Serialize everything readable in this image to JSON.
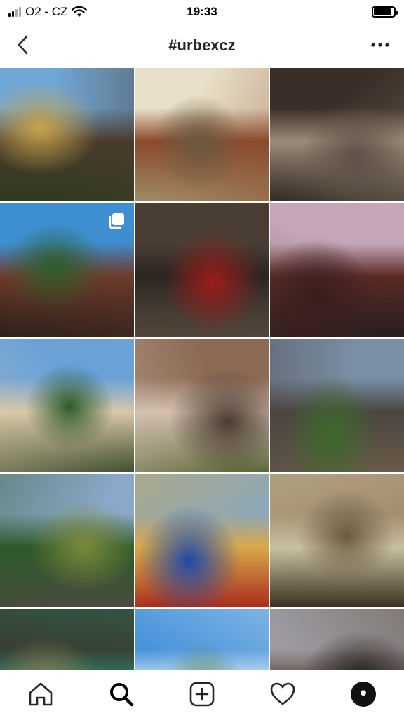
{
  "status_bar": {
    "carrier": "O2 - CZ",
    "time": "19:33",
    "signal_bars": 4,
    "signal_active": 2
  },
  "header": {
    "title": "#urbexcz",
    "back_icon": "chevron-left-icon",
    "more_icon": "more-horizontal-icon"
  },
  "posts": [
    {
      "id": "post-1",
      "subject": "graffiti-face-tower",
      "colors": [
        "#6fa7d6",
        "#4a3b2c",
        "#c7a24a",
        "#2e3b1f"
      ],
      "multi": false
    },
    {
      "id": "post-2",
      "subject": "abandoned-mine-buildings",
      "colors": [
        "#e8e0c8",
        "#8a4a2c",
        "#6b5a40",
        "#a08a64"
      ],
      "multi": false
    },
    {
      "id": "post-3",
      "subject": "ruined-interior-arch",
      "colors": [
        "#3a2f28",
        "#9c8c7a",
        "#5e5046",
        "#2a221c"
      ],
      "multi": false
    },
    {
      "id": "post-4",
      "subject": "woman-on-bridge",
      "colors": [
        "#3d8fd1",
        "#6e3b2a",
        "#2d5e2a",
        "#1e1a18"
      ],
      "multi": true
    },
    {
      "id": "post-5",
      "subject": "woman-red-dress-doors",
      "colors": [
        "#4a3d33",
        "#2a2520",
        "#9c1c1c",
        "#6b5a4a"
      ],
      "multi": false
    },
    {
      "id": "post-6",
      "subject": "dark-brick-tower",
      "colors": [
        "#c4a6b8",
        "#5a2a26",
        "#3a1e1c",
        "#1c1c1c"
      ],
      "multi": false
    },
    {
      "id": "post-7",
      "subject": "factory-pond",
      "colors": [
        "#6aa2d8",
        "#d9c8a8",
        "#2f5a2a",
        "#3a4a2a"
      ],
      "multi": false
    },
    {
      "id": "post-8",
      "subject": "graffiti-brick-wall",
      "colors": [
        "#8c6a54",
        "#d4c0b0",
        "#4a3a30",
        "#5c6a3a"
      ],
      "multi": false
    },
    {
      "id": "post-9",
      "subject": "mine-headframe",
      "colors": [
        "#7a8ea6",
        "#4a4640",
        "#3d6a2a",
        "#6a5a4a"
      ],
      "multi": false
    },
    {
      "id": "post-10",
      "subject": "round-pool-forest",
      "colors": [
        "#8aa8c8",
        "#2f5a2a",
        "#7a8a3a",
        "#4a4a40"
      ],
      "multi": false
    },
    {
      "id": "post-11",
      "subject": "toys-playroom",
      "colors": [
        "#8ca8b8",
        "#d8a848",
        "#1e4aa8",
        "#a82c1c"
      ],
      "multi": false
    },
    {
      "id": "post-12",
      "subject": "washroom-sinks",
      "colors": [
        "#a08a6a",
        "#c8c0a0",
        "#6a5a40",
        "#3a3020"
      ],
      "multi": false
    },
    {
      "id": "post-13",
      "subject": "tiled-corridor",
      "colors": [
        "#3a3028",
        "#2a8a6a",
        "#8a8058",
        "#1c1814"
      ],
      "multi": false
    },
    {
      "id": "post-14",
      "subject": "bridge-walkway",
      "colors": [
        "#3f8fd8",
        "#d8e8f8",
        "#6a8a4a",
        "#9c9080"
      ],
      "multi": false
    },
    {
      "id": "post-15",
      "subject": "attic-beams",
      "colors": [
        "#9c9aa0",
        "#5a4a3c",
        "#2a2420",
        "#e0d8d0"
      ],
      "multi": false
    }
  ],
  "tab_bar": {
    "tabs": [
      {
        "name": "home",
        "icon": "home-icon"
      },
      {
        "name": "search",
        "icon": "search-icon",
        "active": true
      },
      {
        "name": "add",
        "icon": "add-post-icon"
      },
      {
        "name": "activity",
        "icon": "heart-icon"
      },
      {
        "name": "profile",
        "icon": "profile-avatar-icon"
      }
    ]
  }
}
